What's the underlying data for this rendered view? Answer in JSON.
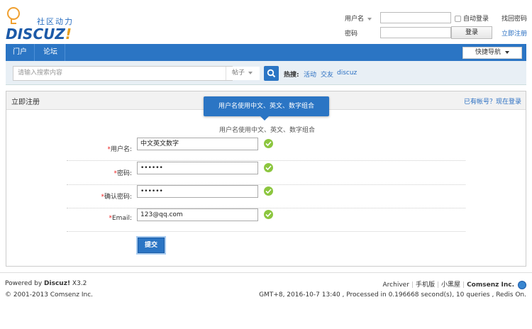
{
  "header": {
    "logo_slogan": "社区动力",
    "logo_word": "DISCUZ",
    "logo_bang": "!",
    "username_label": "用户名",
    "password_label": "密码",
    "auto_login": "自动登录",
    "login_button": "登录",
    "forgot_password": "找回密码",
    "register_link": "立即注册"
  },
  "nav": {
    "items": [
      {
        "label": "门户"
      },
      {
        "label": "论坛"
      }
    ],
    "quick_nav": "快捷导航"
  },
  "search": {
    "placeholder": "请输入搜索内容",
    "type": "帖子",
    "hot_label": "热搜:",
    "hot_links": [
      "活动",
      "交友",
      "discuz"
    ]
  },
  "register": {
    "title": "立即注册",
    "login_link": "已有帐号？现在登录",
    "tooltip": "用户名使用中文、英文、数字组合",
    "hint": "用户名使用中文、英文、数字组合",
    "fields": [
      {
        "label": "用户名:",
        "value": "中文英文数字",
        "required_mark": "*"
      },
      {
        "label": "密码:",
        "value": "••••••",
        "required_mark": "*"
      },
      {
        "label": "确认密码:",
        "value": "••••••",
        "required_mark": "*"
      },
      {
        "label": "Email:",
        "value": "123@qq.com",
        "required_mark": "*"
      }
    ],
    "submit": "提交"
  },
  "footer": {
    "powered_prefix": "Powered by",
    "powered_brand": "Discuz!",
    "powered_version": "X3.2",
    "copyright": "© 2001-2013 Comsenz Inc.",
    "links": [
      "Archiver",
      "手机版",
      "小黑屋"
    ],
    "company": "Comsenz Inc.",
    "stats": "GMT+8, 2016-10-7 13:40 , Processed in 0.196668 second(s), 10 queries , Redis On."
  },
  "colors": {
    "brand_blue": "#2b75c4",
    "link_blue": "#2a6fc2",
    "success_green": "#8cc63f",
    "required_red": "#e22"
  }
}
